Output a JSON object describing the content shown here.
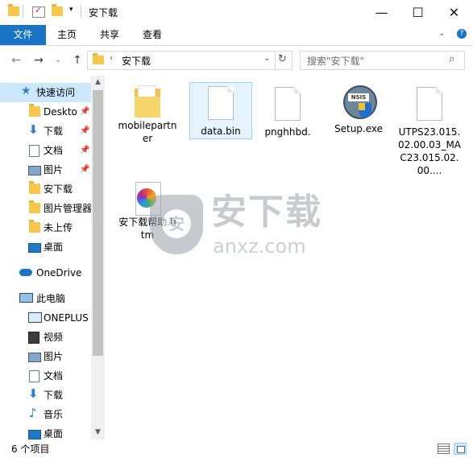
{
  "window": {
    "title": "安下载",
    "minimize": "—",
    "maximize": "☐",
    "close": "✕"
  },
  "ribbon": {
    "tabs": [
      "文件",
      "主页",
      "共享",
      "查看"
    ]
  },
  "nav": {
    "back": "←",
    "forward": "→",
    "recent": "⌄",
    "up": "↑",
    "address": "安下载",
    "search_placeholder": "搜索\"安下载\""
  },
  "sidebar": {
    "items": [
      {
        "label": "快速访问"
      },
      {
        "label": "Deskto"
      },
      {
        "label": "下载"
      },
      {
        "label": "文档"
      },
      {
        "label": "图片"
      },
      {
        "label": "安下载"
      },
      {
        "label": "图片管理器"
      },
      {
        "label": "未上传"
      },
      {
        "label": "桌面"
      },
      {
        "label": "OneDrive"
      },
      {
        "label": "此电脑"
      },
      {
        "label": "ONEPLUS"
      },
      {
        "label": "视频"
      },
      {
        "label": "图片"
      },
      {
        "label": "文档"
      },
      {
        "label": "下载"
      },
      {
        "label": "音乐"
      },
      {
        "label": "桌面"
      }
    ]
  },
  "files": [
    {
      "name": "mobilepartner"
    },
    {
      "name": "data.bin"
    },
    {
      "name": "pnghhbd."
    },
    {
      "name": "Setup.exe"
    },
    {
      "name": "UTPS23.015.02.00.03_MAC23.015.02.00...."
    },
    {
      "name": "安下载帮助.htm"
    }
  ],
  "watermark": {
    "big": "安下载",
    "small": "anxz.com",
    "badge": "安"
  },
  "status": {
    "count": "6 个项目"
  },
  "colors": {
    "accent": "#1a74c6",
    "selection": "#cce8ff",
    "folder": "#f5c84b"
  }
}
